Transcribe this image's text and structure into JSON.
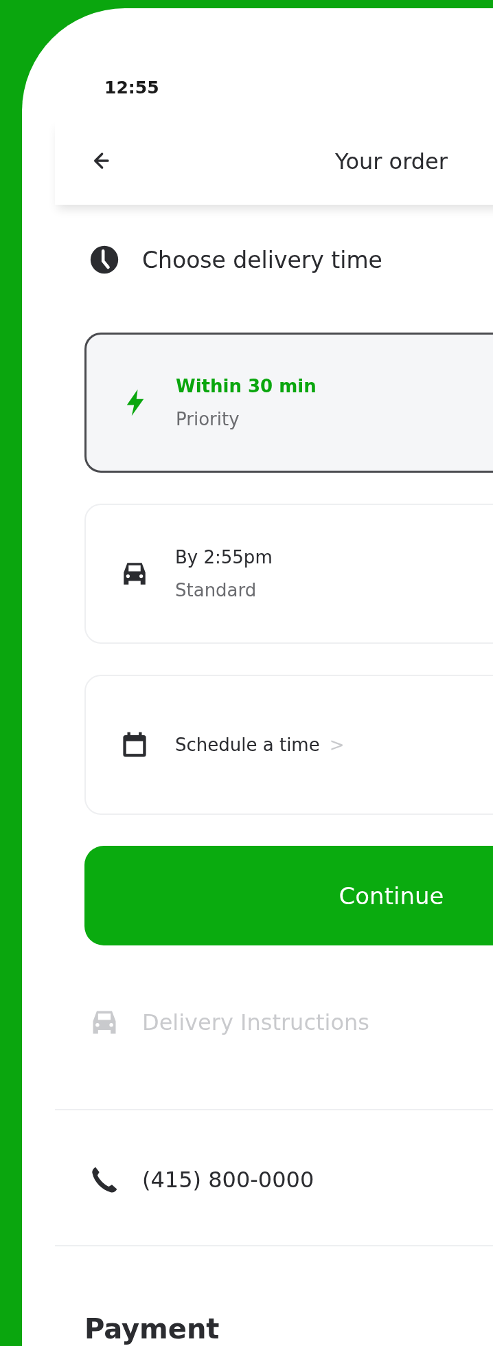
{
  "status_bar": {
    "time": "12:55"
  },
  "header": {
    "title": "Your order"
  },
  "delivery_time": {
    "heading": "Choose delivery time",
    "options": [
      {
        "kind": "option",
        "title": "Within 30 min",
        "subtitle": "Priority",
        "selected": true
      },
      {
        "kind": "option",
        "title": "By 2:55pm",
        "subtitle": "Standard",
        "selected": false
      },
      {
        "kind": "link",
        "title": "Schedule a time",
        "chevron": ">",
        "selected": false
      }
    ],
    "button": "Continue"
  },
  "delivery_instructions": {
    "label": "Delivery Instructions",
    "disabled": true
  },
  "phone": "(415) 800-0000",
  "payment": {
    "heading": "Payment"
  }
}
